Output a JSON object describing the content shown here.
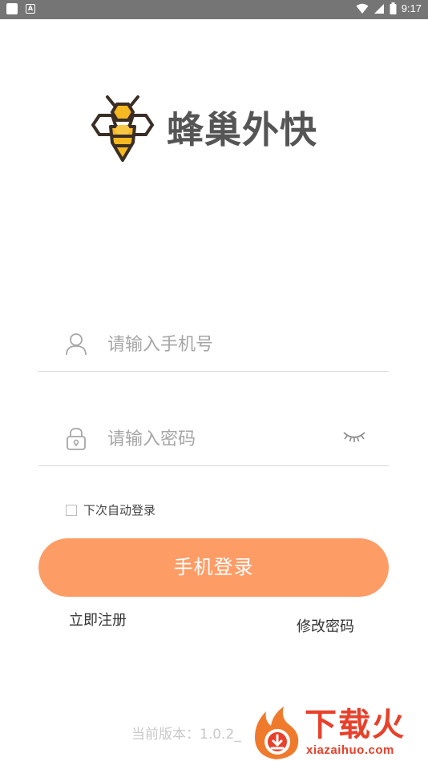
{
  "status_bar": {
    "time": "9:17",
    "left_icons": [
      "notification-square-icon",
      "app-a-icon"
    ],
    "right_icons": [
      "wifi-icon",
      "signal-icon",
      "battery-icon"
    ]
  },
  "logo": {
    "title": "蜂巢外快",
    "icon": "bee-icon"
  },
  "form": {
    "phone_placeholder": "请输入手机号",
    "phone_value": "",
    "password_placeholder": "请输入密码",
    "password_value": "",
    "remember_label": "下次自动登录",
    "remember_checked": false
  },
  "actions": {
    "login_label": "手机登录",
    "register_label": "立即注册",
    "forgot_label": "修改密码"
  },
  "footer": {
    "version": "当前版本：1.0.2_"
  },
  "watermark": {
    "text": "下载火",
    "url": "xiazaihuo.com"
  },
  "colors": {
    "accent": "#fe9c66",
    "status_bar": "#757575",
    "bee_yellow": "#f5b820",
    "watermark": "#e8402a"
  }
}
